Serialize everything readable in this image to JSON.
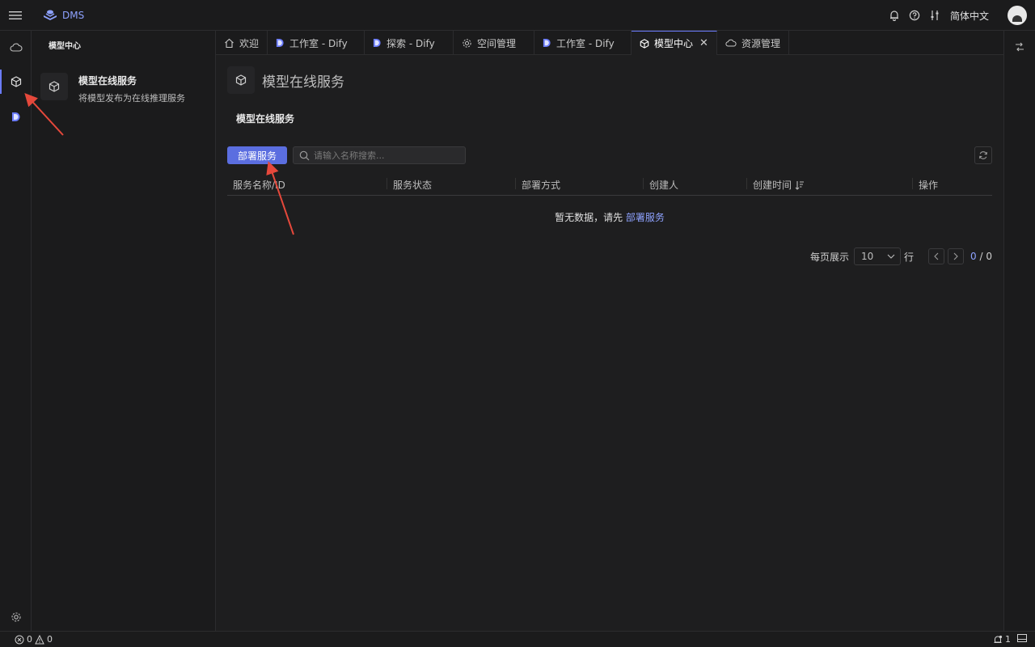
{
  "app": {
    "name": "DMS"
  },
  "header": {
    "language": "简体中文"
  },
  "sidepanel": {
    "title": "模型中心",
    "card": {
      "title": "模型在线服务",
      "subtitle": "将模型发布为在线推理服务"
    }
  },
  "tabs": [
    {
      "label": "欢迎",
      "icon": "home-icon"
    },
    {
      "label": "工作室 - Dify",
      "icon": "dify-icon"
    },
    {
      "label": "探索 - Dify",
      "icon": "dify-icon"
    },
    {
      "label": "空间管理",
      "icon": "gear-icon"
    },
    {
      "label": "工作室 - Dify",
      "icon": "dify-icon"
    },
    {
      "label": "模型中心",
      "icon": "cube-icon",
      "active": true
    },
    {
      "label": "资源管理",
      "icon": "cloud-icon"
    }
  ],
  "main": {
    "page_title": "模型在线服务",
    "section_title": "模型在线服务",
    "deploy_button": "部署服务",
    "search_placeholder": "请输入名称搜索...",
    "columns": [
      "服务名称/ID",
      "服务状态",
      "部署方式",
      "创建人",
      "创建时间",
      "操作"
    ],
    "empty_text": "暂无数据，请先",
    "empty_link": "部署服务",
    "pagination": {
      "per_page_label": "每页展示",
      "page_size": "10",
      "row_label": "行",
      "current": "0",
      "total": "/ 0"
    }
  },
  "statusbar": {
    "errors": "0",
    "warnings": "0",
    "notifications": "1"
  },
  "colors": {
    "accent": "#5b6ee0",
    "link": "#8ea2ff",
    "annotation": "#e5483b"
  }
}
